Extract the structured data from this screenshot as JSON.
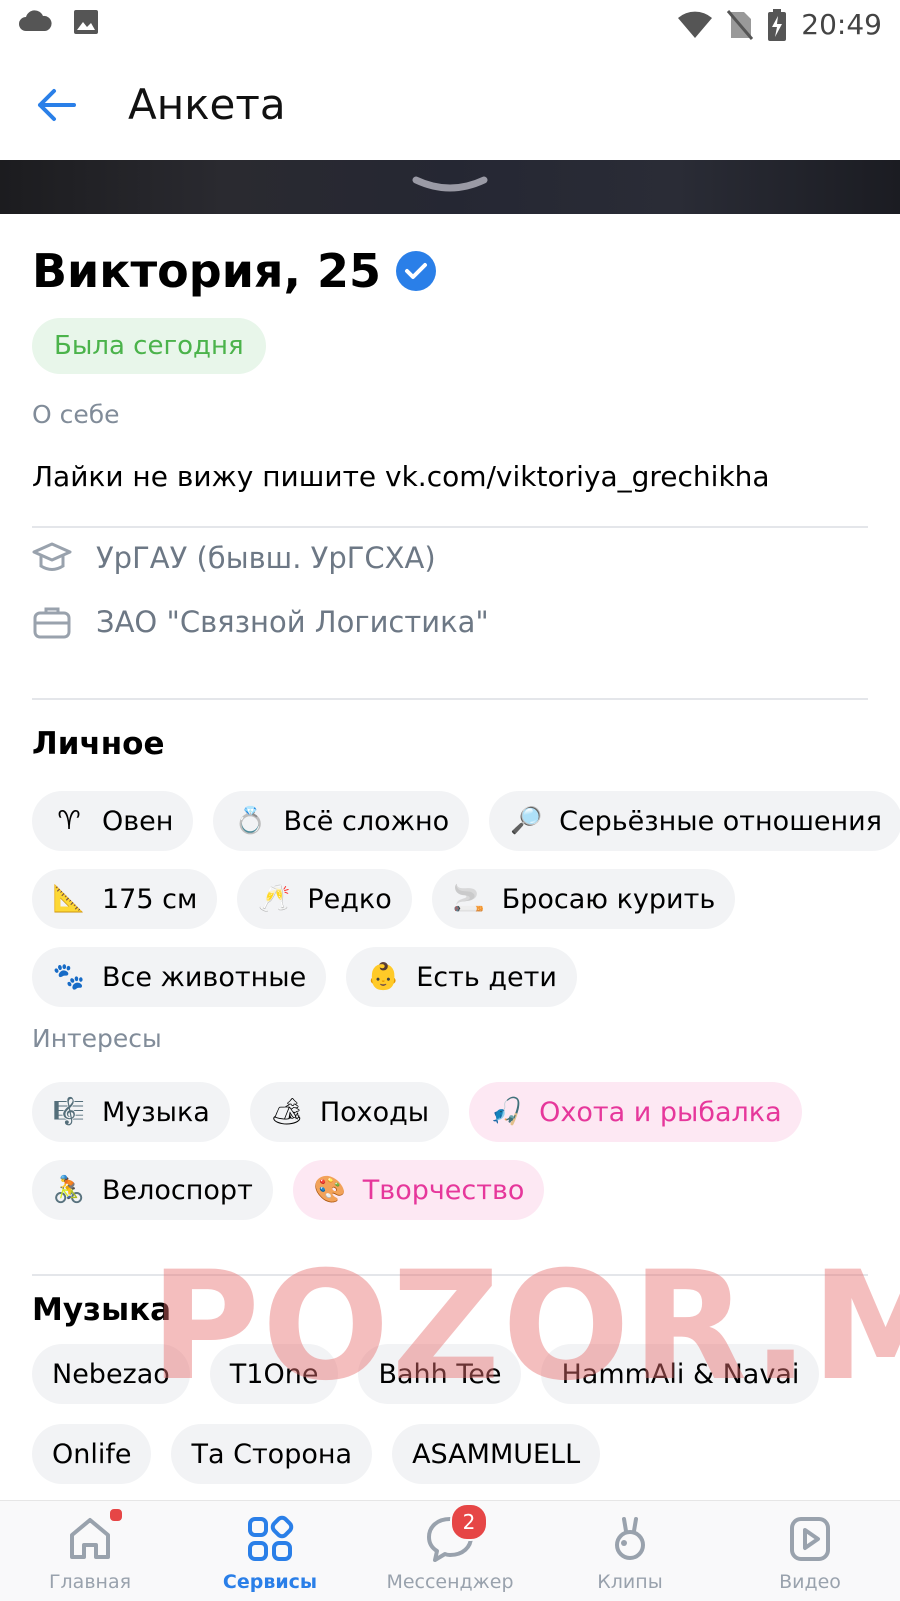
{
  "status_bar": {
    "time": "20:49",
    "icons_left": [
      "cloud-icon",
      "image-icon"
    ],
    "icons_right": [
      "wifi-icon",
      "no-sim-icon",
      "battery-charging-icon"
    ]
  },
  "header": {
    "title": "Анкета",
    "back_icon": "arrow-left-icon"
  },
  "profile": {
    "name_age": "Виктория, 25",
    "verified": true,
    "online_status": "Была сегодня",
    "about_caption": "О себе",
    "about_text": "Лайки не вижу пишите vk.com/viktoriya_grechikha",
    "education": "УрГАУ (бывш. УрГСХА)",
    "work": "ЗАО \"Связной Логистика\""
  },
  "personal": {
    "title": "Личное",
    "rows": [
      [
        {
          "emoji": "♈",
          "label": "Овен"
        },
        {
          "emoji": "💍",
          "label": "Всё сложно"
        },
        {
          "emoji": "🔎",
          "label": "Серьёзные отношения"
        }
      ],
      [
        {
          "emoji": "📐",
          "label": "175 см"
        },
        {
          "emoji": "🥂",
          "label": "Редко"
        },
        {
          "emoji": "🚬",
          "label": "Бросаю курить"
        }
      ],
      [
        {
          "emoji": "🐾",
          "label": "Все животные"
        },
        {
          "emoji": "👶",
          "label": "Есть дети"
        }
      ]
    ]
  },
  "interests": {
    "caption": "Интересы",
    "rows": [
      [
        {
          "emoji": "🎼",
          "label": "Музыка",
          "highlighted": false
        },
        {
          "emoji": "🏕",
          "label": "Походы",
          "highlighted": false
        },
        {
          "emoji": "🎣",
          "label": "Охота и рыбалка",
          "highlighted": true
        }
      ],
      [
        {
          "emoji": "🚴",
          "label": "Велоспорт",
          "highlighted": false
        },
        {
          "emoji": "🎨",
          "label": "Творчество",
          "highlighted": true
        }
      ]
    ]
  },
  "music": {
    "title": "Музыка",
    "rows": [
      [
        "Nebezao",
        "T1One",
        "Bahh Tee",
        "HammAli & Navai"
      ],
      [
        "Onlife",
        "Та Сторона",
        "ASAMMUELL"
      ]
    ]
  },
  "watermark": "POZOR.ME",
  "bottom_nav": [
    {
      "label": "Главная",
      "icon": "home-icon",
      "active": false,
      "dot": true
    },
    {
      "label": "Сервисы",
      "icon": "services-grid-icon",
      "active": true
    },
    {
      "label": "Мессенджер",
      "icon": "chat-bubble-icon",
      "active": false,
      "badge": "2"
    },
    {
      "label": "Клипы",
      "icon": "clips-icon",
      "active": false
    },
    {
      "label": "Видео",
      "icon": "video-play-icon",
      "active": false
    }
  ],
  "colors": {
    "accent_blue": "#2a7fe8",
    "online_green": "#4bb34b",
    "pink_highlight": "#e6379b",
    "badge_red": "#e64646"
  }
}
